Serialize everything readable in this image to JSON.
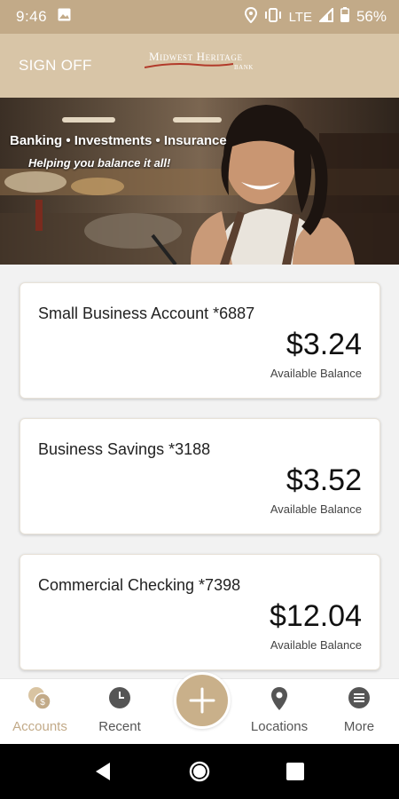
{
  "status_bar": {
    "time": "9:46",
    "network": "LTE",
    "battery": "56%",
    "icons": [
      "image-icon",
      "location-icon",
      "vibrate-icon",
      "signal-icon",
      "battery-icon"
    ]
  },
  "header": {
    "sign_off": "SIGN OFF",
    "logo": {
      "line1": "Midwest Heritage",
      "line2": "BANK",
      "sub": ""
    }
  },
  "banner": {
    "headline": "Banking • Investments • Insurance",
    "tagline": "Helping you balance it all!"
  },
  "accounts": [
    {
      "name": "Small Business Account *6887",
      "balance": "$3.24",
      "balance_label": "Available Balance"
    },
    {
      "name": "Business Savings *3188",
      "balance": "$3.52",
      "balance_label": "Available Balance"
    },
    {
      "name": "Commercial Checking *7398",
      "balance": "$12.04",
      "balance_label": "Available Balance"
    }
  ],
  "bottom_nav": {
    "items": [
      {
        "label": "Accounts",
        "icon": "coins-icon",
        "active": true
      },
      {
        "label": "Recent",
        "icon": "clock-icon",
        "active": false
      },
      {
        "label": "",
        "icon": "plus-icon",
        "active": false
      },
      {
        "label": "Locations",
        "icon": "location-pin-icon",
        "active": false
      },
      {
        "label": "More",
        "icon": "menu-icon",
        "active": false
      }
    ]
  },
  "colors": {
    "brand": "#c2aa88",
    "header_bg": "#d8c5a7",
    "fab": "#c9b08a"
  }
}
